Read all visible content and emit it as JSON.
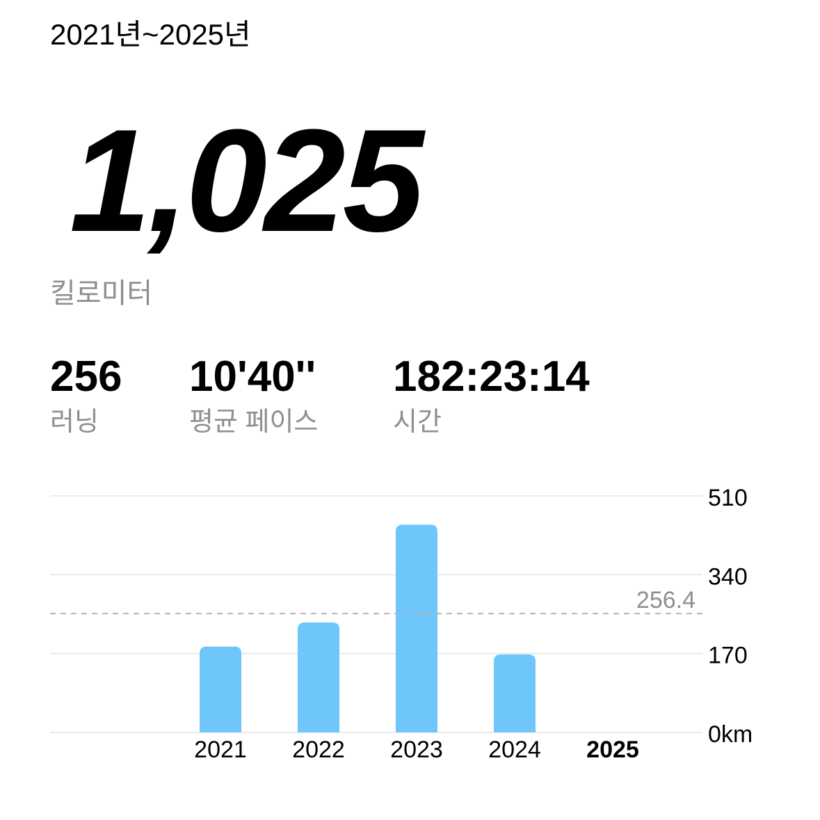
{
  "header": {
    "period": "2021년~2025년"
  },
  "total": {
    "value": "1,025",
    "unit": "킬로미터"
  },
  "stats": [
    {
      "value": "256",
      "label": "러닝"
    },
    {
      "value": "10'40''",
      "label": "평균 페이스"
    },
    {
      "value": "182:23:14",
      "label": "시간"
    }
  ],
  "chart_data": {
    "type": "bar",
    "categories": [
      "2021",
      "2022",
      "2023",
      "2024",
      "2025"
    ],
    "values": [
      185,
      237,
      448,
      168,
      0
    ],
    "selected_category": "2025",
    "average": 256.4,
    "average_label": "256.4",
    "y_ticks": [
      "510",
      "340",
      "170",
      "0km"
    ],
    "y_tick_values": [
      510,
      340,
      170,
      0
    ],
    "ylim": [
      0,
      510
    ],
    "grid": true,
    "y_axis_side": "right",
    "bar_color": "#6ec6fa",
    "grid_color": "#e3e3e3",
    "average_line_color": "#b5b5b5",
    "average_label_color": "#8e8e93"
  }
}
